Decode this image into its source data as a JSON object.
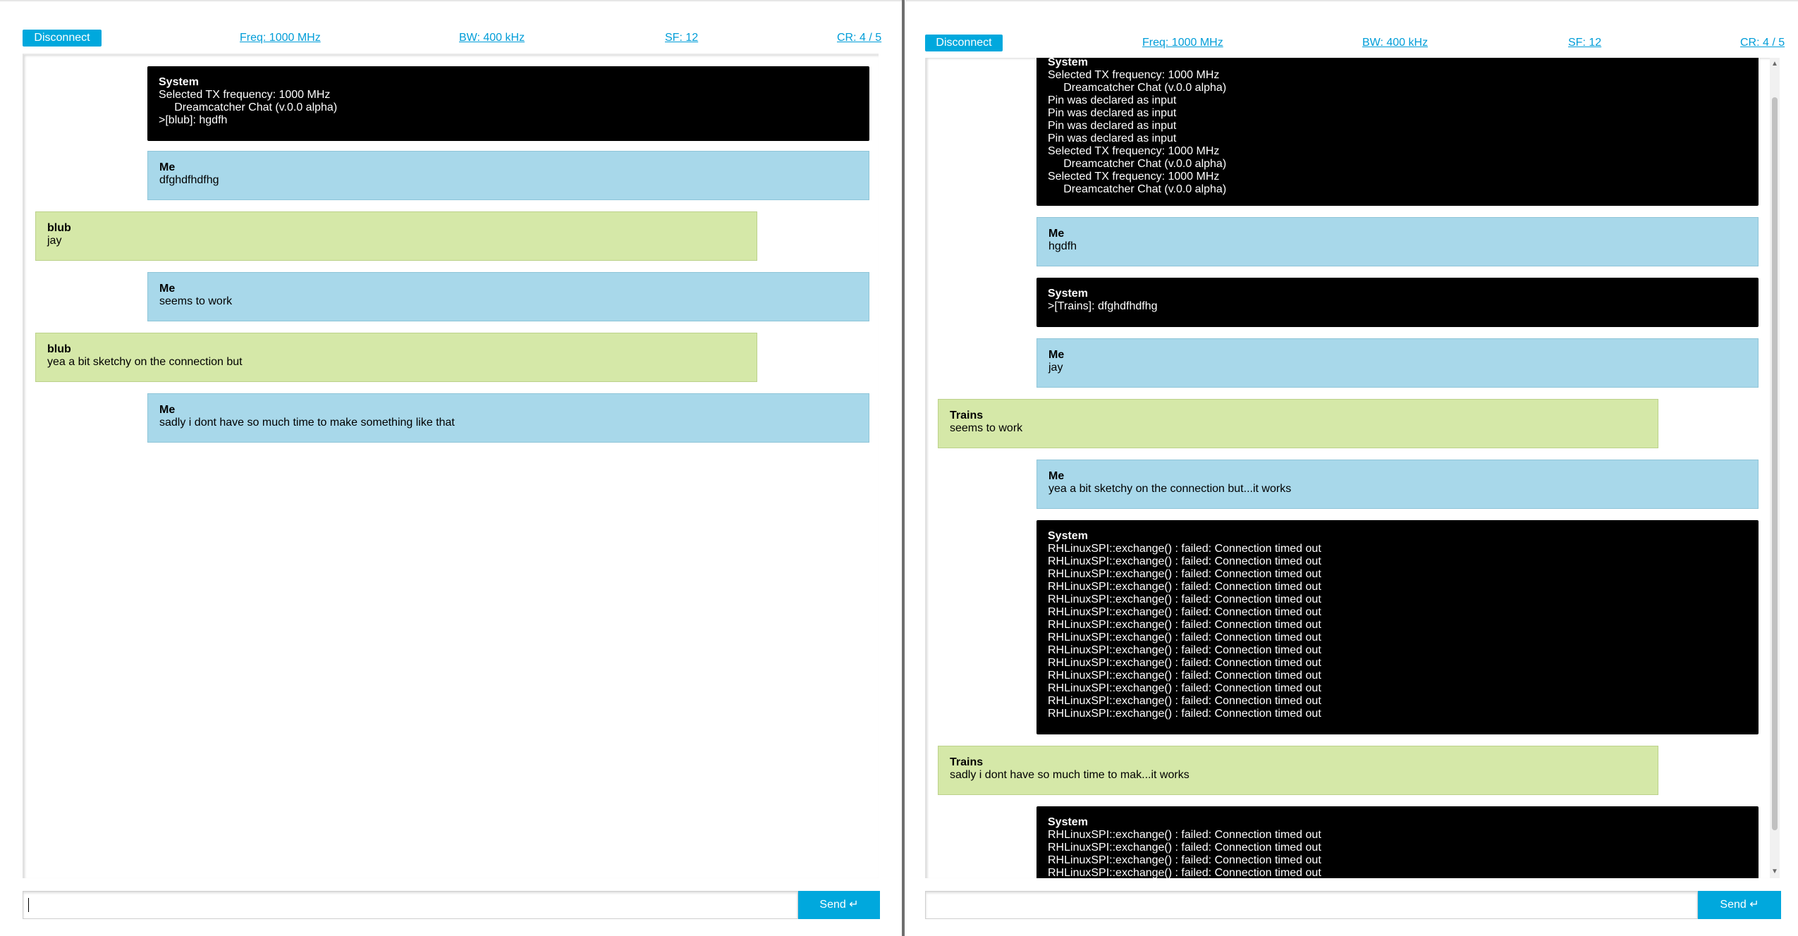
{
  "left": {
    "header": {
      "disconnect_label": "Disconnect",
      "freq": "Freq: 1000 MHz",
      "bw": "BW: 400 kHz",
      "sf": "SF: 12",
      "cr": "CR: 4 / 5"
    },
    "messages": [
      {
        "sender": "System",
        "lines": [
          "Selected TX frequency: 1000 MHz",
          "     Dreamcatcher Chat (v.0.0 alpha)",
          ">[blub]: hgdfh"
        ]
      },
      {
        "sender": "Me",
        "lines": [
          "dfghdfhdfhg"
        ]
      },
      {
        "sender": "blub",
        "lines": [
          "jay"
        ]
      },
      {
        "sender": "Me",
        "lines": [
          "seems to work"
        ]
      },
      {
        "sender": "blub",
        "lines": [
          "yea a bit sketchy on the connection but"
        ]
      },
      {
        "sender": "Me",
        "lines": [
          "sadly i dont have so much time to make something like that"
        ]
      }
    ],
    "input": {
      "value": "",
      "placeholder": ""
    },
    "send_label": "Send ↵"
  },
  "right": {
    "header": {
      "disconnect_label": "Disconnect",
      "freq": "Freq: 1000 MHz",
      "bw": "BW: 400 kHz",
      "sf": "SF: 12",
      "cr": "CR: 4 / 5"
    },
    "messages": [
      {
        "sender": "System",
        "lines": [
          "Selected TX frequency: 1000 MHz",
          "     Dreamcatcher Chat (v.0.0 alpha)",
          "Pin was declared as input",
          "Pin was declared as input",
          "Pin was declared as input",
          "Pin was declared as input",
          "Selected TX frequency: 1000 MHz",
          "     Dreamcatcher Chat (v.0.0 alpha)",
          "Selected TX frequency: 1000 MHz",
          "     Dreamcatcher Chat (v.0.0 alpha)"
        ]
      },
      {
        "sender": "Me",
        "lines": [
          "hgdfh"
        ]
      },
      {
        "sender": "System",
        "lines": [
          ">[Trains]: dfghdfhdfhg"
        ]
      },
      {
        "sender": "Me",
        "lines": [
          "jay"
        ]
      },
      {
        "sender": "Trains",
        "lines": [
          "seems to work"
        ]
      },
      {
        "sender": "Me",
        "lines": [
          "yea a bit sketchy on the connection but...it works"
        ]
      },
      {
        "sender": "System",
        "lines": [
          "RHLinuxSPI::exchange() : failed: Connection timed out",
          "RHLinuxSPI::exchange() : failed: Connection timed out",
          "RHLinuxSPI::exchange() : failed: Connection timed out",
          "RHLinuxSPI::exchange() : failed: Connection timed out",
          "RHLinuxSPI::exchange() : failed: Connection timed out",
          "RHLinuxSPI::exchange() : failed: Connection timed out",
          "RHLinuxSPI::exchange() : failed: Connection timed out",
          "RHLinuxSPI::exchange() : failed: Connection timed out",
          "RHLinuxSPI::exchange() : failed: Connection timed out",
          "RHLinuxSPI::exchange() : failed: Connection timed out",
          "RHLinuxSPI::exchange() : failed: Connection timed out",
          "RHLinuxSPI::exchange() : failed: Connection timed out",
          "RHLinuxSPI::exchange() : failed: Connection timed out",
          "RHLinuxSPI::exchange() : failed: Connection timed out"
        ]
      },
      {
        "sender": "Trains",
        "lines": [
          "sadly i dont have so much time to mak...it works"
        ]
      },
      {
        "sender": "System",
        "lines": [
          "RHLinuxSPI::exchange() : failed: Connection timed out",
          "RHLinuxSPI::exchange() : failed: Connection timed out",
          "RHLinuxSPI::exchange() : failed: Connection timed out",
          "RHLinuxSPI::exchange() : failed: Connection timed out"
        ]
      }
    ],
    "input": {
      "value": "",
      "placeholder": ""
    },
    "send_label": "Send ↵"
  },
  "colors": {
    "accent": "#00a8dd",
    "me_bubble": "#a8d8ea",
    "peer_bubble": "#d5e8a8",
    "system_bubble": "#000000"
  }
}
